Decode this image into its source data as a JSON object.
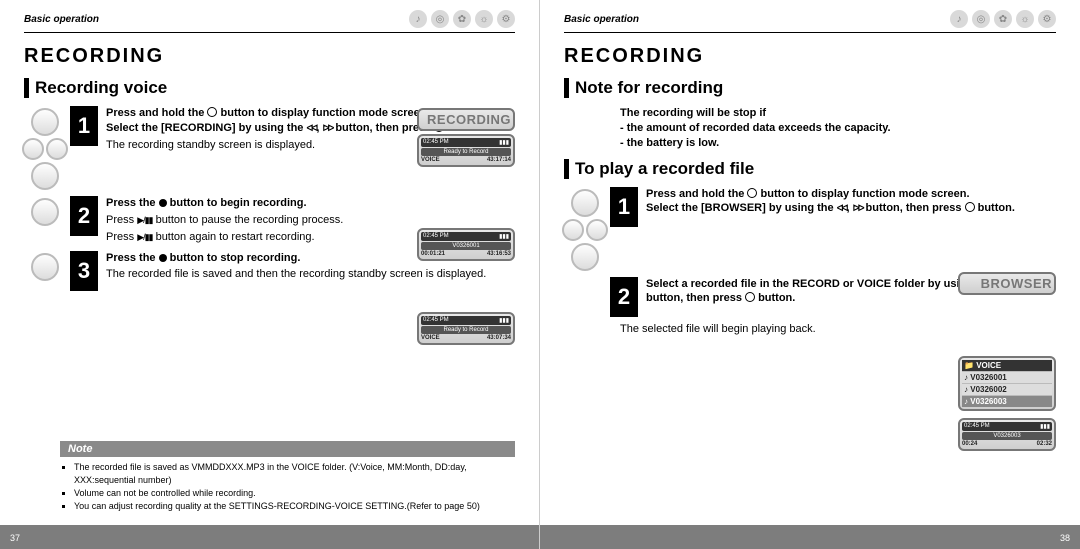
{
  "left": {
    "breadcrumb": "Basic operation",
    "h1": "RECORDING",
    "h2": "Recording voice",
    "steps": [
      {
        "lead1": "Press and hold the ",
        "lead2": " button to display function mode screen.",
        "lead3": "Select the [RECORDING] by using the ",
        "lead4": " button, then press ",
        "lead5": " button.",
        "sub": "The recording standby screen is displayed."
      },
      {
        "lead1": "Press the ",
        "lead2": " button to begin recording.",
        "sub1": "Press ",
        "sub2": " button to pause the recording process.",
        "sub3": "Press ",
        "sub4": " button again to restart recording."
      },
      {
        "lead1": "Press the ",
        "lead2": " button to stop recording.",
        "sub": "The recorded file is saved and then the recording standby screen is displayed."
      }
    ],
    "note": {
      "title": "Note",
      "items": [
        "The recorded file is saved as VMMDDXXX.MP3 in the VOICE folder. (V:Voice, MM:Month, DD:day, XXX:sequential number)",
        "Volume can not be controlled while recording.",
        "You can adjust recording quality at the SETTINGS-RECORDING-VOICE SETTING.(Refer to page 50)"
      ]
    },
    "screens": {
      "recording_label": "RECORDING",
      "ready": "Ready to Record",
      "voice_tag": "VOICE",
      "time1": "43:17:14",
      "clock": "02:45 PM",
      "file": "V0326001",
      "elapsed": "00:01:21",
      "remain": "43:16:53",
      "time2": "43:07:34"
    },
    "page_num": "37"
  },
  "right": {
    "breadcrumb": "Basic operation",
    "h1": "RECORDING",
    "h2a": "Note for recording",
    "warn": {
      "lead": "The recording will be stop if",
      "d1": "- the amount of recorded data exceeds the capacity.",
      "d2": "- the battery is low."
    },
    "h2b": "To play a recorded file",
    "steps": [
      {
        "lead1": "Press and hold the ",
        "lead2": " button to display function mode screen.",
        "lead3": "Select the [BROWSER] by using the ",
        "lead4": " button, then press ",
        "lead5": " button."
      },
      {
        "lead1": "Select a recorded file in the RECORD or VOICE folder by using the ",
        "lead2": " button, then ",
        "lead3": "press ",
        "lead4": " button."
      }
    ],
    "sub_after": "The selected file will begin playing back.",
    "screens": {
      "browser_label": "BROWSER",
      "voice_hdr": "VOICE",
      "files": [
        "V0326001",
        "V0326002",
        "V0326003"
      ],
      "play_file": "V0326003",
      "clock": "02:45 PM",
      "elapsed": "00:24",
      "total": "02:32"
    },
    "page_num": "38"
  },
  "glyph_names": {
    "center": "center-select-icon",
    "prev": "prev-track-icon",
    "next": "next-track-icon",
    "rec": "record-dot-icon",
    "playpause": "play-pause-icon",
    "plus": "plus-icon",
    "minus": "minus-icon"
  }
}
